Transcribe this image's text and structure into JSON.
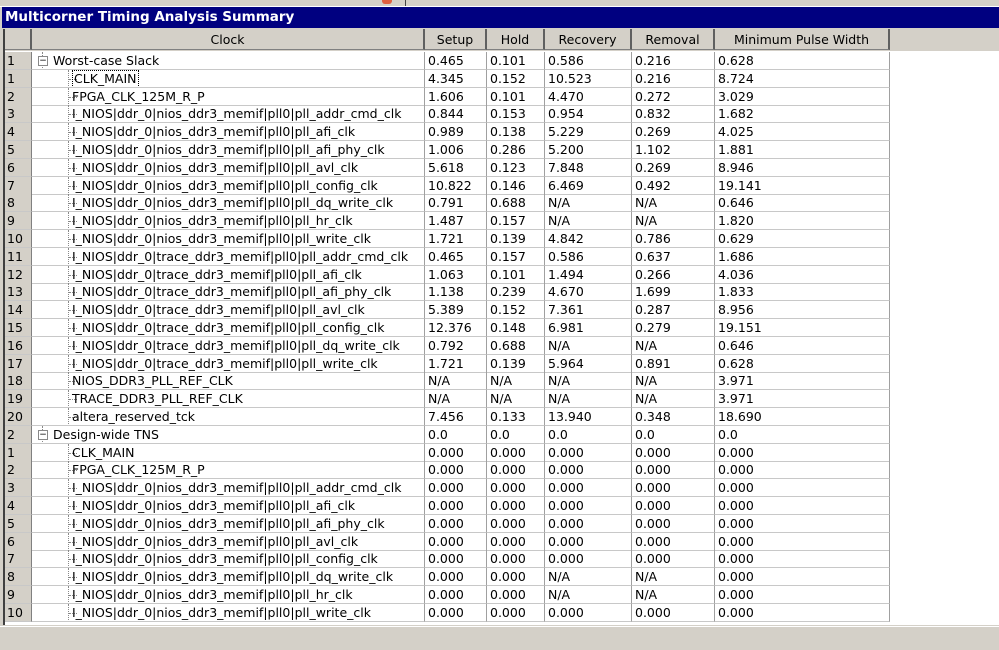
{
  "window": {
    "title": "Multicorner Timing Analysis Summary"
  },
  "columns": [
    "",
    "Clock",
    "Setup",
    "Hold",
    "Recovery",
    "Removal",
    "Minimum Pulse Width"
  ],
  "groups": [
    {
      "index": "1",
      "name": "Worst-case Slack",
      "values": [
        "0.465",
        "0.101",
        "0.586",
        "0.216",
        "0.628"
      ],
      "rows": [
        [
          "1",
          "CLK_MAIN",
          "4.345",
          "0.152",
          "10.523",
          "0.216",
          "8.724"
        ],
        [
          "2",
          "FPGA_CLK_125M_R_P",
          "1.606",
          "0.101",
          "4.470",
          "0.272",
          "3.029"
        ],
        [
          "3",
          "I_NIOS|ddr_0|nios_ddr3_memif|pll0|pll_addr_cmd_clk",
          "0.844",
          "0.153",
          "0.954",
          "0.832",
          "1.682"
        ],
        [
          "4",
          "I_NIOS|ddr_0|nios_ddr3_memif|pll0|pll_afi_clk",
          "0.989",
          "0.138",
          "5.229",
          "0.269",
          "4.025"
        ],
        [
          "5",
          "I_NIOS|ddr_0|nios_ddr3_memif|pll0|pll_afi_phy_clk",
          "1.006",
          "0.286",
          "5.200",
          "1.102",
          "1.881"
        ],
        [
          "6",
          "I_NIOS|ddr_0|nios_ddr3_memif|pll0|pll_avl_clk",
          "5.618",
          "0.123",
          "7.848",
          "0.269",
          "8.946"
        ],
        [
          "7",
          "I_NIOS|ddr_0|nios_ddr3_memif|pll0|pll_config_clk",
          "10.822",
          "0.146",
          "6.469",
          "0.492",
          "19.141"
        ],
        [
          "8",
          "I_NIOS|ddr_0|nios_ddr3_memif|pll0|pll_dq_write_clk",
          "0.791",
          "0.688",
          "N/A",
          "N/A",
          "0.646"
        ],
        [
          "9",
          "I_NIOS|ddr_0|nios_ddr3_memif|pll0|pll_hr_clk",
          "1.487",
          "0.157",
          "N/A",
          "N/A",
          "1.820"
        ],
        [
          "10",
          "I_NIOS|ddr_0|nios_ddr3_memif|pll0|pll_write_clk",
          "1.721",
          "0.139",
          "4.842",
          "0.786",
          "0.629"
        ],
        [
          "11",
          "I_NIOS|ddr_0|trace_ddr3_memif|pll0|pll_addr_cmd_clk",
          "0.465",
          "0.157",
          "0.586",
          "0.637",
          "1.686"
        ],
        [
          "12",
          "I_NIOS|ddr_0|trace_ddr3_memif|pll0|pll_afi_clk",
          "1.063",
          "0.101",
          "1.494",
          "0.266",
          "4.036"
        ],
        [
          "13",
          "I_NIOS|ddr_0|trace_ddr3_memif|pll0|pll_afi_phy_clk",
          "1.138",
          "0.239",
          "4.670",
          "1.699",
          "1.833"
        ],
        [
          "14",
          "I_NIOS|ddr_0|trace_ddr3_memif|pll0|pll_avl_clk",
          "5.389",
          "0.152",
          "7.361",
          "0.287",
          "8.956"
        ],
        [
          "15",
          "I_NIOS|ddr_0|trace_ddr3_memif|pll0|pll_config_clk",
          "12.376",
          "0.148",
          "6.981",
          "0.279",
          "19.151"
        ],
        [
          "16",
          "I_NIOS|ddr_0|trace_ddr3_memif|pll0|pll_dq_write_clk",
          "0.792",
          "0.688",
          "N/A",
          "N/A",
          "0.646"
        ],
        [
          "17",
          "I_NIOS|ddr_0|trace_ddr3_memif|pll0|pll_write_clk",
          "1.721",
          "0.139",
          "5.964",
          "0.891",
          "0.628"
        ],
        [
          "18",
          "NIOS_DDR3_PLL_REF_CLK",
          "N/A",
          "N/A",
          "N/A",
          "N/A",
          "3.971"
        ],
        [
          "19",
          "TRACE_DDR3_PLL_REF_CLK",
          "N/A",
          "N/A",
          "N/A",
          "N/A",
          "3.971"
        ],
        [
          "20",
          "altera_reserved_tck",
          "7.456",
          "0.133",
          "13.940",
          "0.348",
          "18.690"
        ]
      ]
    },
    {
      "index": "2",
      "name": "Design-wide TNS",
      "values": [
        "0.0",
        "0.0",
        "0.0",
        "0.0",
        "0.0"
      ],
      "rows": [
        [
          "1",
          "CLK_MAIN",
          "0.000",
          "0.000",
          "0.000",
          "0.000",
          "0.000"
        ],
        [
          "2",
          "FPGA_CLK_125M_R_P",
          "0.000",
          "0.000",
          "0.000",
          "0.000",
          "0.000"
        ],
        [
          "3",
          "I_NIOS|ddr_0|nios_ddr3_memif|pll0|pll_addr_cmd_clk",
          "0.000",
          "0.000",
          "0.000",
          "0.000",
          "0.000"
        ],
        [
          "4",
          "I_NIOS|ddr_0|nios_ddr3_memif|pll0|pll_afi_clk",
          "0.000",
          "0.000",
          "0.000",
          "0.000",
          "0.000"
        ],
        [
          "5",
          "I_NIOS|ddr_0|nios_ddr3_memif|pll0|pll_afi_phy_clk",
          "0.000",
          "0.000",
          "0.000",
          "0.000",
          "0.000"
        ],
        [
          "6",
          "I_NIOS|ddr_0|nios_ddr3_memif|pll0|pll_avl_clk",
          "0.000",
          "0.000",
          "0.000",
          "0.000",
          "0.000"
        ],
        [
          "7",
          "I_NIOS|ddr_0|nios_ddr3_memif|pll0|pll_config_clk",
          "0.000",
          "0.000",
          "0.000",
          "0.000",
          "0.000"
        ],
        [
          "8",
          "I_NIOS|ddr_0|nios_ddr3_memif|pll0|pll_dq_write_clk",
          "0.000",
          "0.000",
          "N/A",
          "N/A",
          "0.000"
        ],
        [
          "9",
          "I_NIOS|ddr_0|nios_ddr3_memif|pll0|pll_hr_clk",
          "0.000",
          "0.000",
          "N/A",
          "N/A",
          "0.000"
        ],
        [
          "10",
          "I_NIOS|ddr_0|nios_ddr3_memif|pll0|pll_write_clk",
          "0.000",
          "0.000",
          "0.000",
          "0.000",
          "0.000"
        ]
      ]
    }
  ]
}
